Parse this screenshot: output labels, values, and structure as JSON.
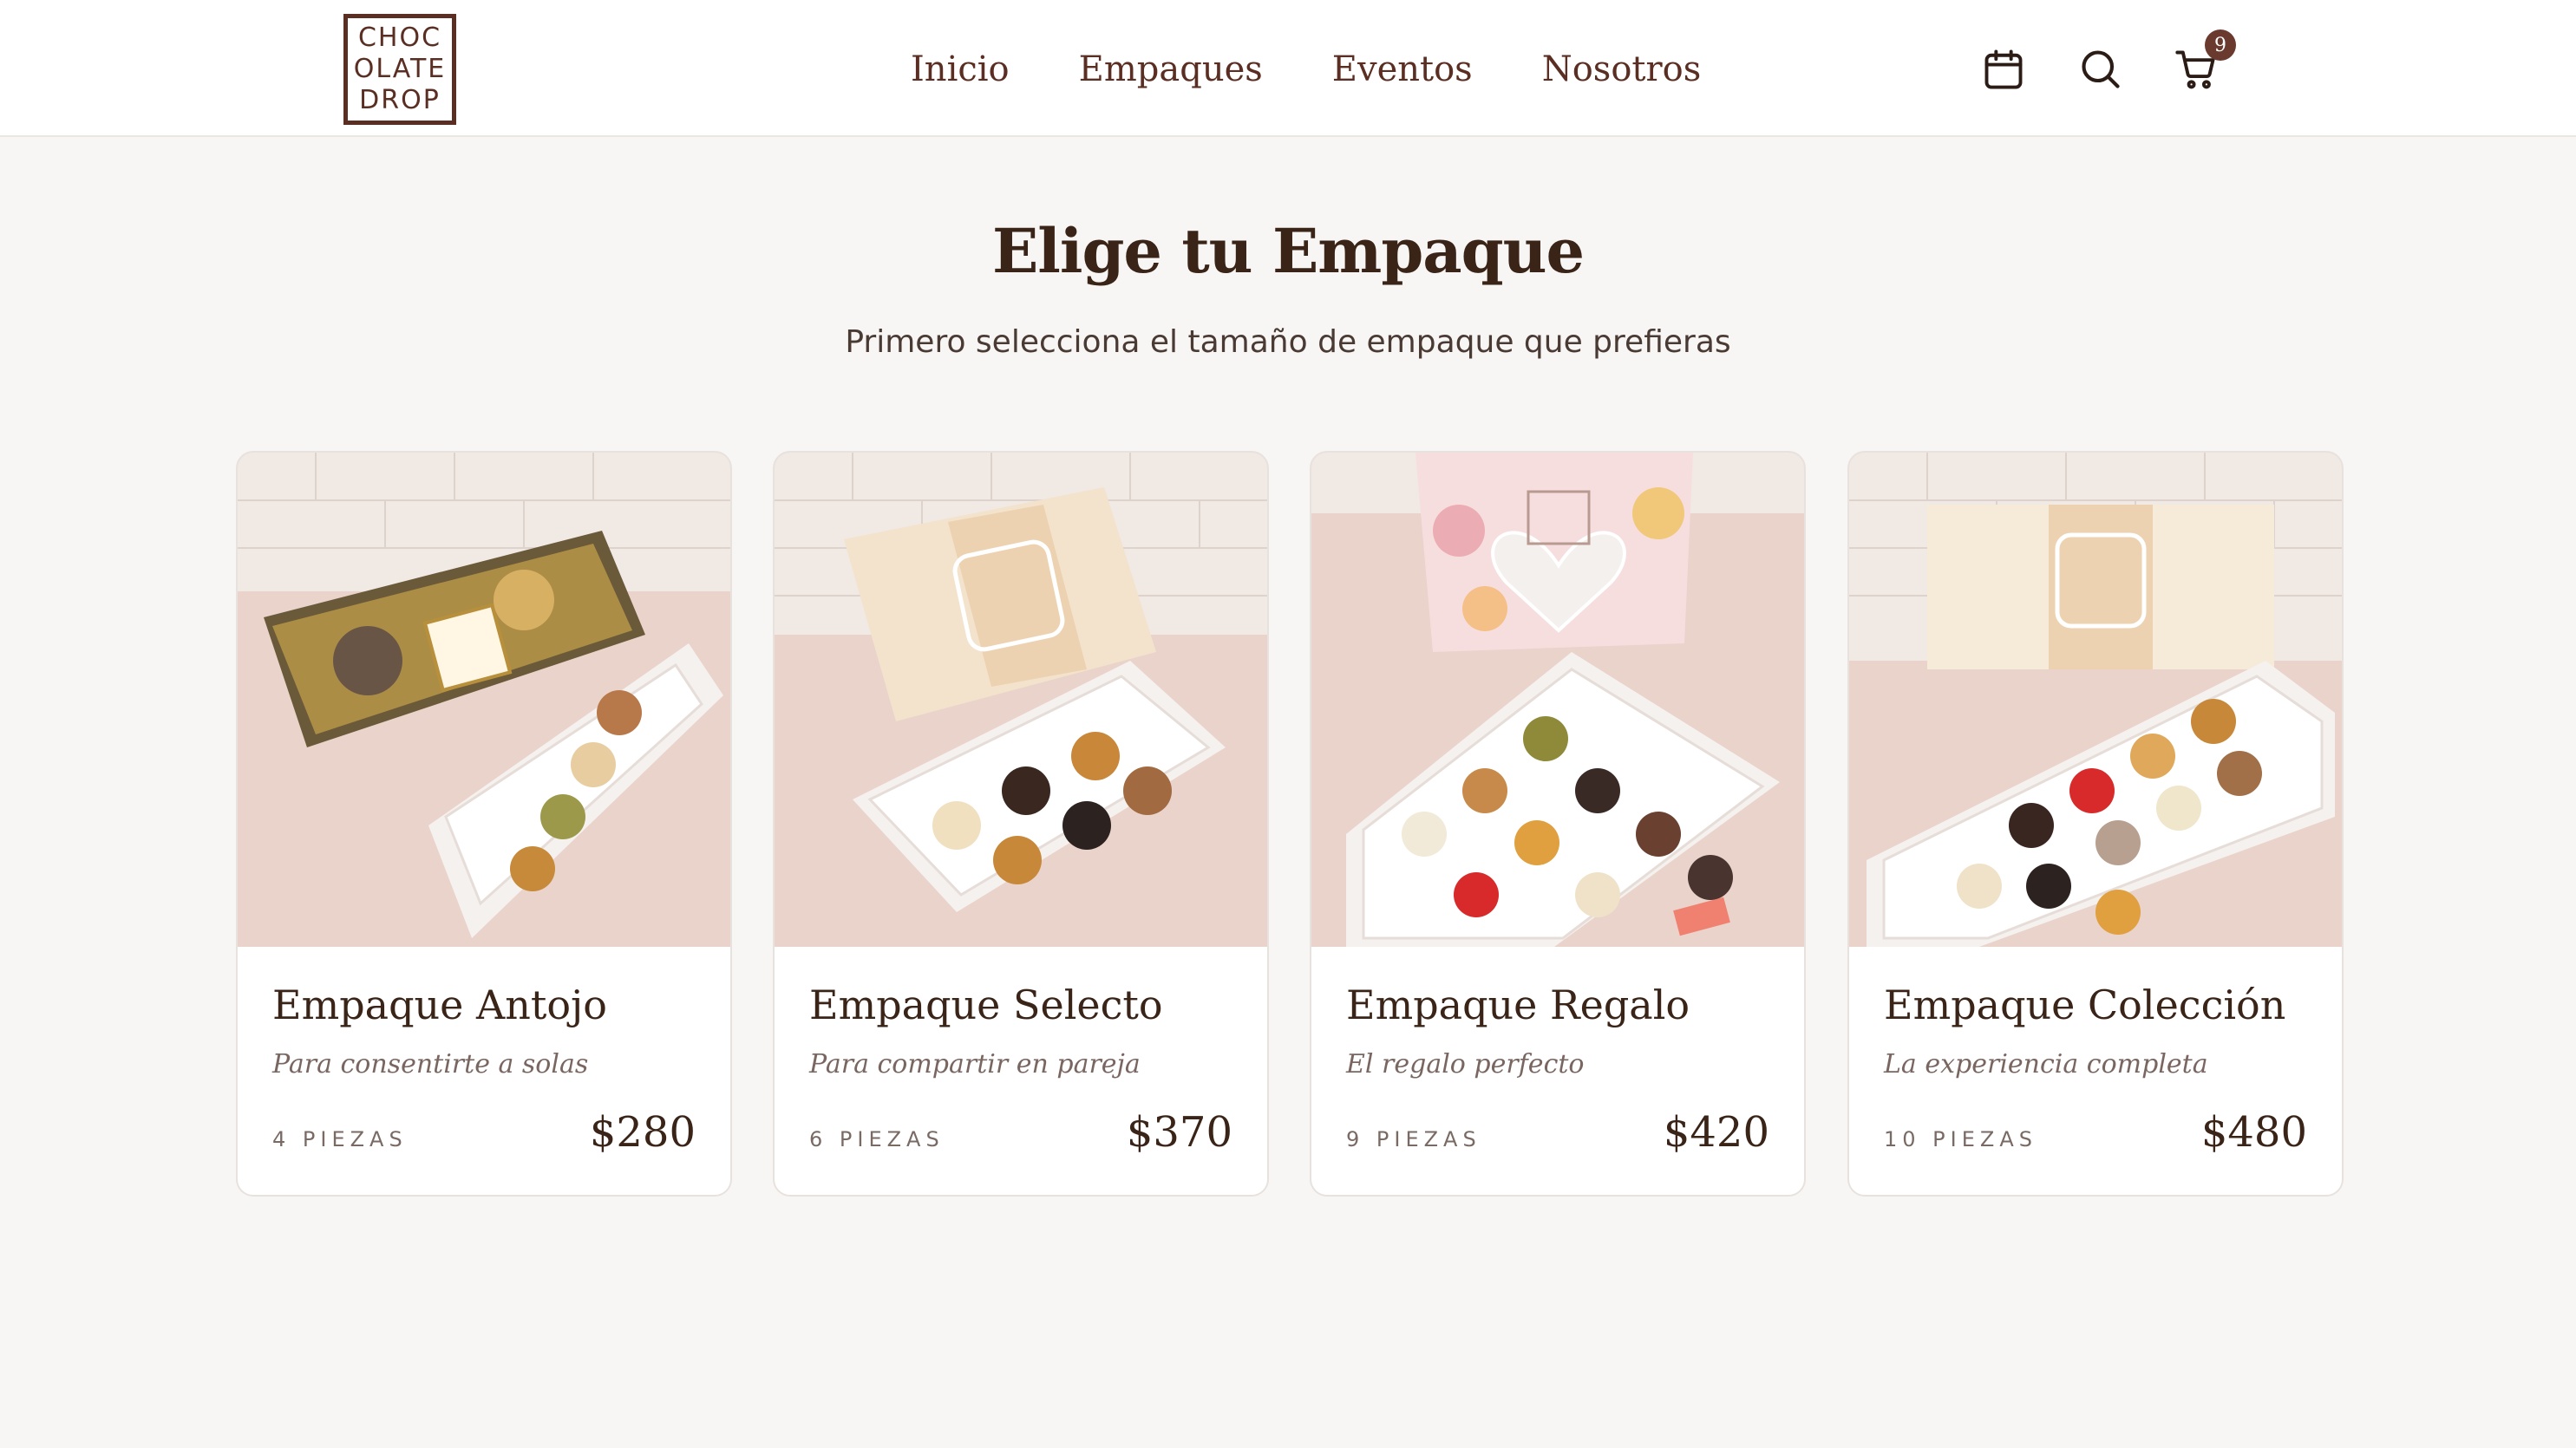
{
  "brand": {
    "logo_lines": [
      "CHOC",
      "OLATE",
      "DROP"
    ]
  },
  "nav": {
    "items": [
      {
        "label": "Inicio"
      },
      {
        "label": "Empaques"
      },
      {
        "label": "Eventos"
      },
      {
        "label": "Nosotros"
      }
    ]
  },
  "header_icons": {
    "calendar": "calendar-icon",
    "search": "search-icon",
    "cart": "cart-icon",
    "cart_count": "9"
  },
  "main": {
    "title": "Elige tu Empaque",
    "subtitle": "Primero selecciona el tamaño de empaque que prefieras"
  },
  "packages": [
    {
      "name": "Empaque Antojo",
      "tagline": "Para consentirte a solas",
      "pieces": "4 PIEZAS",
      "price": "$280"
    },
    {
      "name": "Empaque Selecto",
      "tagline": "Para compartir en pareja",
      "pieces": "6 PIEZAS",
      "price": "$370"
    },
    {
      "name": "Empaque Regalo",
      "tagline": "El regalo perfecto",
      "pieces": "9 PIEZAS",
      "price": "$420"
    },
    {
      "name": "Empaque Colección",
      "tagline": "La experiencia completa",
      "pieces": "10 PIEZAS",
      "price": "$480"
    }
  ],
  "colors": {
    "brand_brown": "#5a2e22",
    "heading": "#3a2418",
    "background": "#f8f6f4",
    "card_bg": "#ffffff",
    "photo_bg": "#ecd8d1"
  }
}
